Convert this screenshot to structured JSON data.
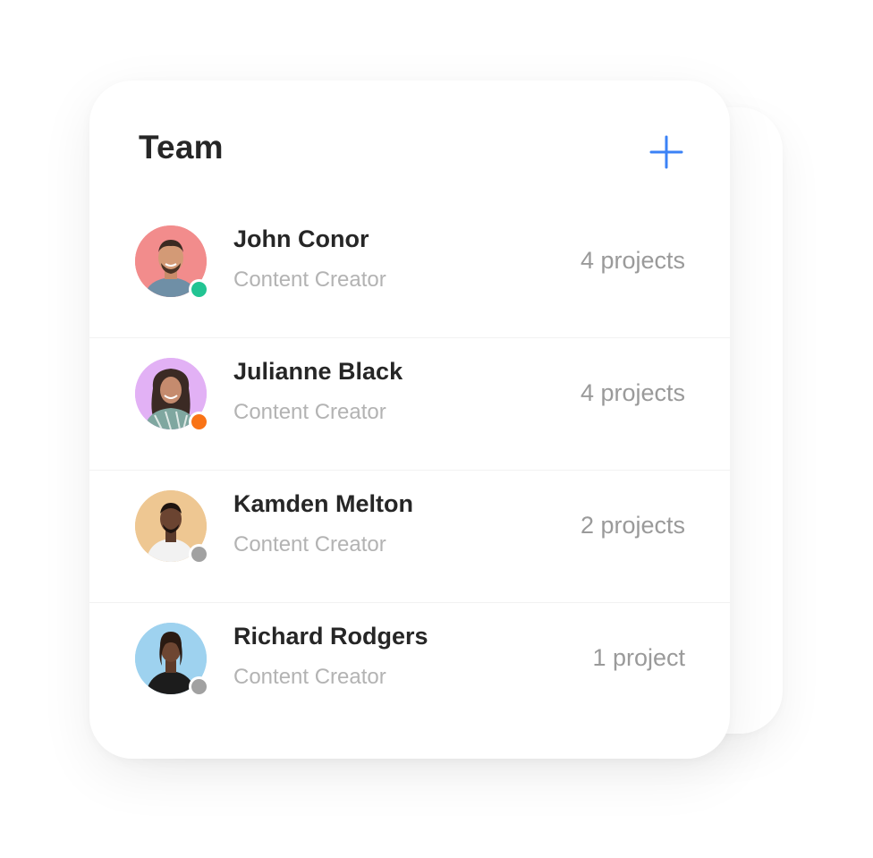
{
  "header": {
    "title": "Team",
    "add_icon": "plus-icon",
    "accent_color": "#3b82f6"
  },
  "members": [
    {
      "name": "John Conor",
      "role": "Content Creator",
      "projects": "4 projects",
      "avatar_bg": "#f28c8c",
      "status_color": "#22c493"
    },
    {
      "name": "Julianne Black",
      "role": "Content Creator",
      "projects": "4 projects",
      "avatar_bg": "#e2b1f5",
      "status_color": "#f97316"
    },
    {
      "name": "Kamden Melton",
      "role": "Content Creator",
      "projects": "2 projects",
      "avatar_bg": "#eec792",
      "status_color": "#a1a1a1"
    },
    {
      "name": "Richard Rodgers",
      "role": "Content Creator",
      "projects": "1 project",
      "avatar_bg": "#9ed2ef",
      "status_color": "#a1a1a1"
    }
  ]
}
